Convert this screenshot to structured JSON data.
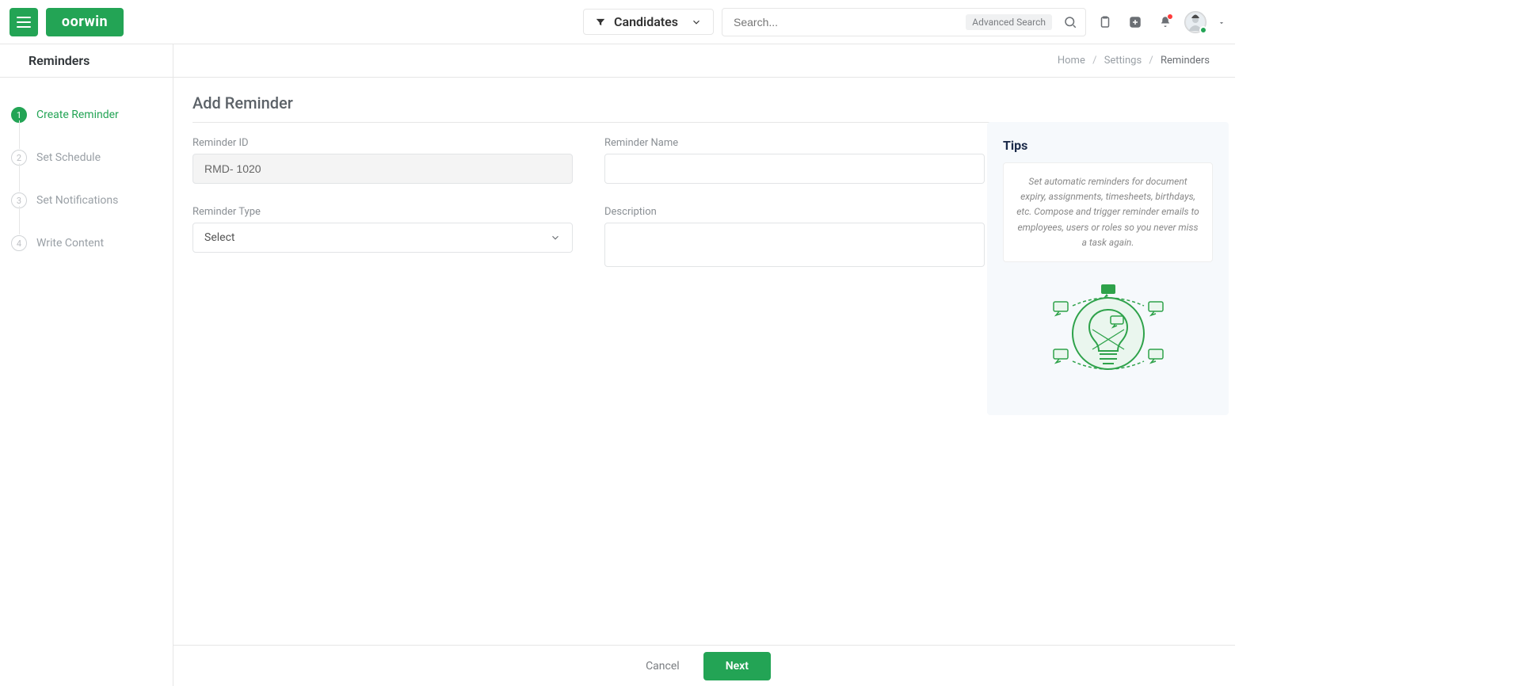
{
  "topbar": {
    "brand": "oorwin",
    "filter_label": "Candidates",
    "search_placeholder": "Search...",
    "advanced_search": "Advanced Search"
  },
  "subheader": {
    "title": "Reminders",
    "breadcrumb": [
      "Home",
      "Settings",
      "Reminders"
    ]
  },
  "steps": [
    {
      "num": "1",
      "label": "Create Reminder",
      "active": true
    },
    {
      "num": "2",
      "label": "Set Schedule",
      "active": false
    },
    {
      "num": "3",
      "label": "Set Notifications",
      "active": false
    },
    {
      "num": "4",
      "label": "Write Content",
      "active": false
    }
  ],
  "form": {
    "title": "Add Reminder",
    "reminder_id_label": "Reminder ID",
    "reminder_id_value": "RMD- 1020",
    "reminder_name_label": "Reminder Name",
    "reminder_name_value": "",
    "reminder_type_label": "Reminder Type",
    "reminder_type_value": "Select",
    "description_label": "Description",
    "description_value": ""
  },
  "tips": {
    "title": "Tips",
    "text": "Set automatic reminders for document expiry, assignments, timesheets, birthdays, etc. Compose and trigger reminder emails to employees, users or roles so you never miss a task again."
  },
  "footer": {
    "cancel": "Cancel",
    "next": "Next"
  }
}
